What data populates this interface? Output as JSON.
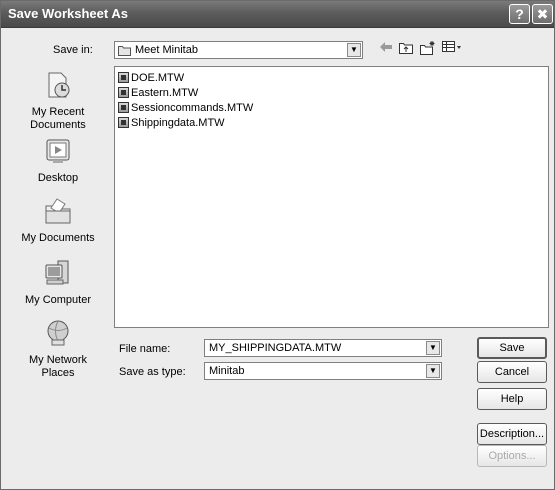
{
  "window": {
    "title": "Save Worksheet As"
  },
  "titlebar_buttons": {
    "help": "?",
    "close": "✖"
  },
  "save_in": {
    "label": "Save in:",
    "value": "Meet Minitab"
  },
  "places": [
    {
      "label_line1": "My Recent",
      "label_line2": "Documents",
      "icon": "recent-documents-icon"
    },
    {
      "label_line1": "Desktop",
      "label_line2": "",
      "icon": "desktop-icon"
    },
    {
      "label_line1": "My Documents",
      "label_line2": "",
      "icon": "my-documents-icon"
    },
    {
      "label_line1": "My Computer",
      "label_line2": "",
      "icon": "my-computer-icon"
    },
    {
      "label_line1": "My Network",
      "label_line2": "Places",
      "icon": "network-places-icon"
    }
  ],
  "files": [
    "DOE.MTW",
    "Eastern.MTW",
    "Sessioncommands.MTW",
    "Shippingdata.MTW"
  ],
  "file_name": {
    "label": "File name:",
    "value": "MY_SHIPPINGDATA.MTW"
  },
  "save_as_type": {
    "label": "Save as type:",
    "value": "Minitab"
  },
  "buttons": {
    "save": "Save",
    "cancel": "Cancel",
    "help": "Help",
    "description": "Description...",
    "options": "Options..."
  }
}
